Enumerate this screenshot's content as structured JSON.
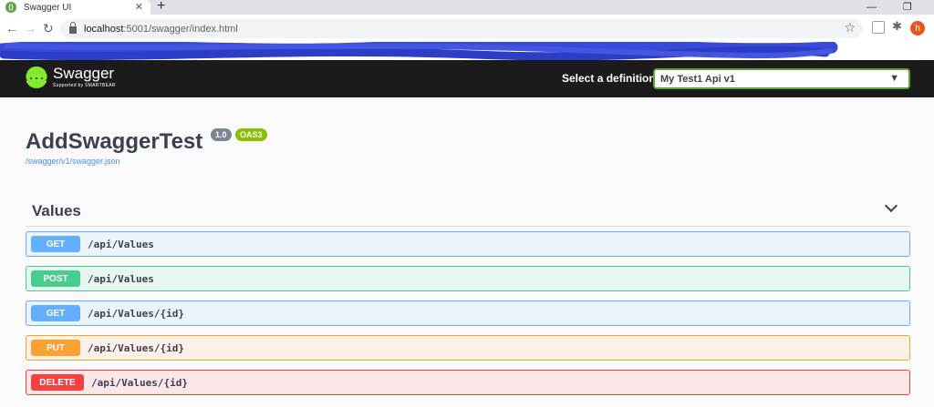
{
  "browser": {
    "tab_title": "Swagger UI",
    "tab_favicon": "{}",
    "url_host": "localhost",
    "url_path": ":5001/swagger/index.html",
    "profile_initial": "h"
  },
  "swagger": {
    "logo_name": "Swagger",
    "logo_sub": "Supported by SMARTBEAR",
    "logo_mark": "{...}",
    "definition_label": "Select a definition",
    "definition_value": "My Test1 Api v1",
    "title": "AddSwaggerTest",
    "version": "1.0",
    "oas": "OAS3",
    "spec_link": "/swagger/v1/swagger.json",
    "tag": "Values",
    "operations": [
      {
        "method": "GET",
        "path": "/api/Values",
        "color": "#61affe",
        "bg": "#ebf3fb",
        "border": "#61affe"
      },
      {
        "method": "POST",
        "path": "/api/Values",
        "color": "#49cc90",
        "bg": "#e8f6f0",
        "border": "#49cc90"
      },
      {
        "method": "GET",
        "path": "/api/Values/{id}",
        "color": "#61affe",
        "bg": "#ebf3fb",
        "border": "#61affe"
      },
      {
        "method": "PUT",
        "path": "/api/Values/{id}",
        "color": "#fca130",
        "bg": "#fbf1e6",
        "border": "#fca130"
      },
      {
        "method": "DELETE",
        "path": "/api/Values/{id}",
        "color": "#f93e3e",
        "bg": "#fae7e7",
        "border": "#f93e3e"
      }
    ]
  },
  "colors": {
    "topbar_bg": "#1b1b1b",
    "accent_green": "#62a03f",
    "text": "#3b4151"
  },
  "icons": {
    "back": "arrow-left-icon",
    "forward": "arrow-right-icon",
    "reload": "reload-icon",
    "lock": "lock-icon",
    "star": "star-icon",
    "puzzle": "puzzle-icon"
  }
}
